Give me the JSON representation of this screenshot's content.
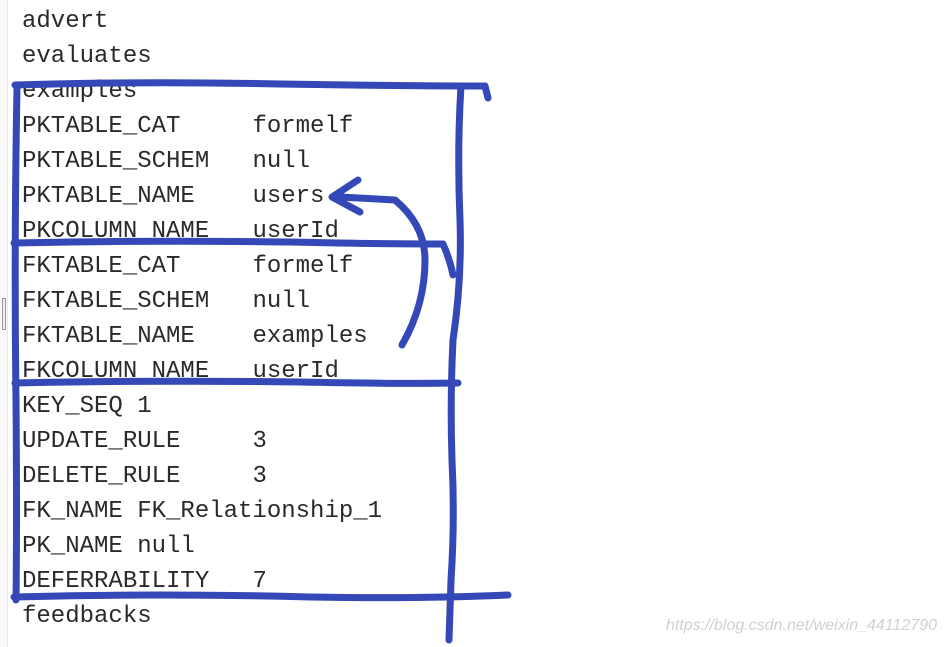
{
  "lines": {
    "l0": "advert",
    "l1": "evaluates",
    "l2": "examples",
    "l3": "PKTABLE_CAT     formelf",
    "l4": "PKTABLE_SCHEM   null",
    "l5": "PKTABLE_NAME    users",
    "l6": "PKCOLUMN_NAME   userId",
    "l7": "FKTABLE_CAT     formelf",
    "l8": "FKTABLE_SCHEM   null",
    "l9": "FKTABLE_NAME    examples",
    "l10": "FKCOLUMN_NAME   userId",
    "l11": "KEY_SEQ 1",
    "l12": "UPDATE_RULE     3",
    "l13": "DELETE_RULE     3",
    "l14": "FK_NAME FK_Relationship_1",
    "l15": "PK_NAME null",
    "l16": "DEFERRABILITY   7",
    "l17": "feedbacks"
  },
  "watermark": "https://blog.csdn.net/weixin_44112790",
  "annotation_color": "#3548b8"
}
